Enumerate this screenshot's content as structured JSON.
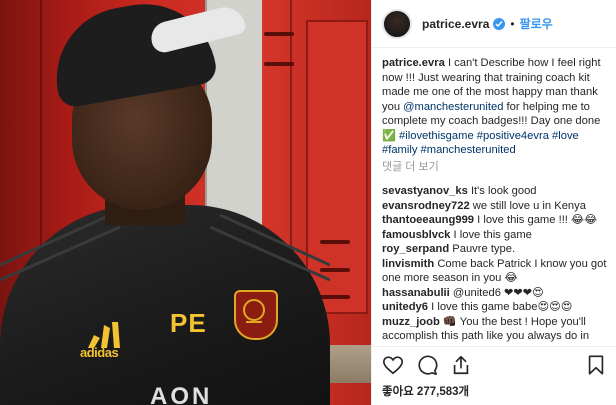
{
  "post": {
    "author": "patrice.evra",
    "follow_label": "팔로우",
    "dot": "•",
    "caption_text": "I can't Describe how I feel right now !!! Just wearing that training coach kit made me one of the most happy man thank you ",
    "caption_mention": "@manchesterunited",
    "caption_text2": " for helping me to complete my coach badges!!! Day one done ✅ ",
    "hashtags": "#ilovethisgame #positive4evra #love #family #manchesterunited",
    "more_comments_label": "댓글 더 보기",
    "likes_label": "좋아요 277,583개"
  },
  "photo": {
    "jersey_initials": "PE",
    "sponsor": "adidas",
    "chest_print": "AON"
  },
  "comments": [
    {
      "user": "sevastyanov_ks",
      "text": "It's look good"
    },
    {
      "user": "evansrodney722",
      "text": "we still love u in Kenya"
    },
    {
      "user": "thantoeeaung999",
      "text": "I love this game !!! 😂😂"
    },
    {
      "user": "famousblvck",
      "text": "I love this game"
    },
    {
      "user": "roy_serpand",
      "text": "Pauvre type."
    },
    {
      "user": "linvismith",
      "text": "Come back Patrick I know you got one more season in you 😂"
    },
    {
      "user": "hassanabulii",
      "text": "@united6 ❤❤❤😍"
    },
    {
      "user": "unitedy6",
      "text": "I love this game babe😍😍😍"
    },
    {
      "user": "muzz_joob",
      "text": "👊🏿 You the best ! Hope you'll accomplish this path like you always do in the pitch ! Much love for you / congratulations"
    }
  ],
  "colors": {
    "accent_blue": "#3897f0",
    "link_blue": "#003569",
    "locker_red": "#c92a20",
    "kit_gold": "#f2c230"
  }
}
